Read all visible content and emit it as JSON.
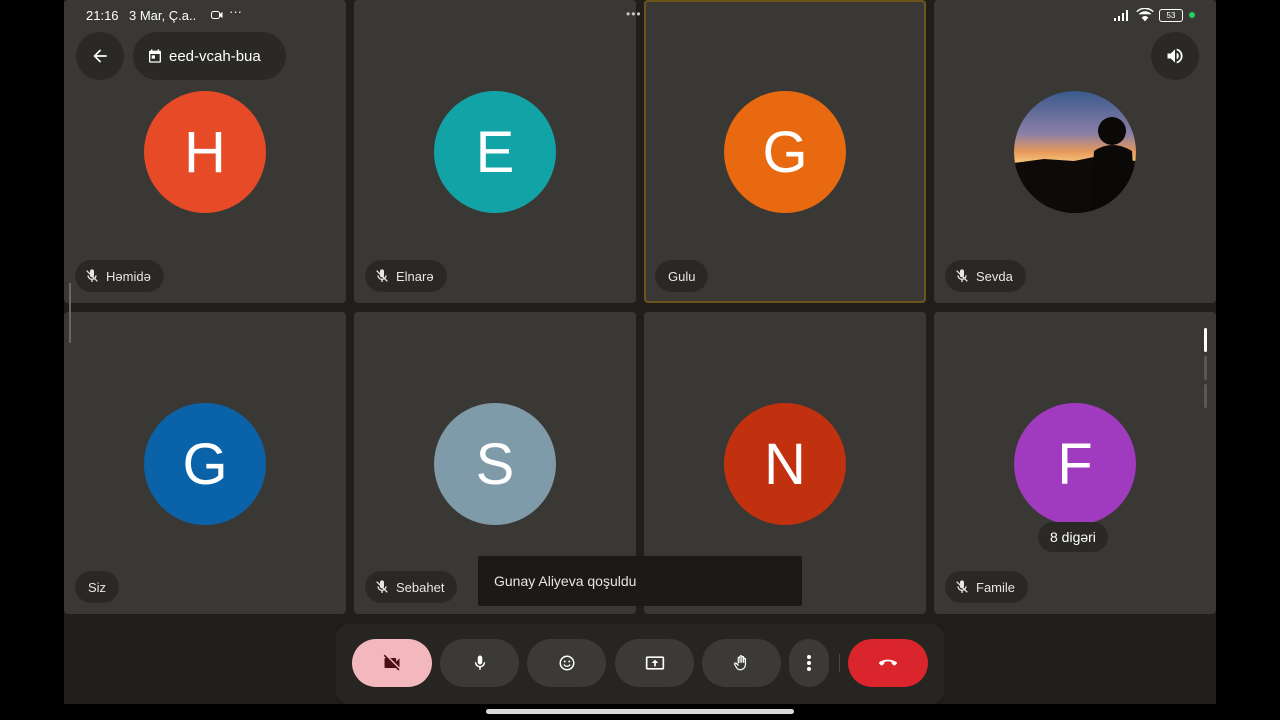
{
  "status_bar": {
    "time": "21:16",
    "date": "3 Mar, Ç.a..",
    "more": "···",
    "battery": "53"
  },
  "meeting": {
    "code": "eed-vcah-bua"
  },
  "window_dots": "•••",
  "participants": [
    {
      "initial": "H",
      "name": "Həmidə",
      "color": "#e64a27",
      "muted": true
    },
    {
      "initial": "E",
      "name": "Elnarə",
      "color": "#11a3a6",
      "muted": true
    },
    {
      "initial": "G",
      "name": "Gulu",
      "color": "#e8690f",
      "muted": false,
      "speaking": true
    },
    {
      "initial": "",
      "name": "Sevda",
      "muted": true,
      "photo": true
    },
    {
      "initial": "G",
      "name": "Siz",
      "color": "#0a63a8",
      "muted": false
    },
    {
      "initial": "S",
      "name": "Sebahet",
      "color": "#7f9aa8",
      "muted": true
    },
    {
      "initial": "N",
      "name": "",
      "color": "#c1300f",
      "muted": false
    },
    {
      "initial": "F",
      "name": "Famile",
      "color": "#a03bbf",
      "muted": true
    }
  ],
  "others_label": "8 digəri",
  "toast": "Gunay Aliyeva qoşuldu",
  "toolbar": {
    "camera": "videocam-off-icon",
    "mic": "mic-icon",
    "reactions": "emoji-icon",
    "present": "present-screen-icon",
    "raise_hand": "hand-icon",
    "more": "more-vert-icon",
    "leave": "call-end-icon"
  },
  "colors": {
    "leave": "#d9252b",
    "camera_off_bg": "#f2b8bd",
    "speaking_border": "#6b5518"
  }
}
